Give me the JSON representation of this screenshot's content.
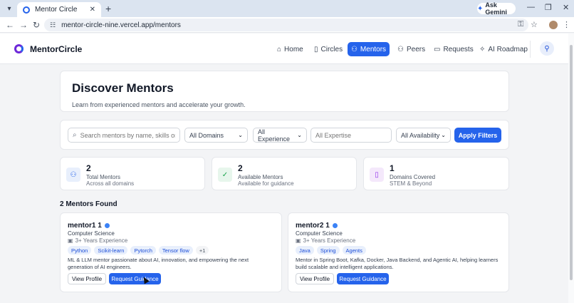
{
  "browser": {
    "tab_title": "Mentor Circle",
    "url": "mentor-circle-nine.vercel.app/mentors",
    "ask_gemini": "Ask Gemini"
  },
  "app": {
    "brand": "MentorCircle",
    "nav": [
      {
        "label": "Home",
        "icon": "home-icon"
      },
      {
        "label": "Circles",
        "icon": "book-icon"
      },
      {
        "label": "Mentors",
        "icon": "users-icon",
        "active": true
      },
      {
        "label": "Peers",
        "icon": "users-icon"
      },
      {
        "label": "Requests",
        "icon": "message-icon"
      },
      {
        "label": "AI Roadmap",
        "icon": "sparkles-icon"
      }
    ]
  },
  "hero": {
    "title": "Discover Mentors",
    "subtitle": "Learn from experienced mentors and accelerate your growth."
  },
  "filters": {
    "search_placeholder": "Search mentors by name, skills or domain",
    "domain": "All Domains",
    "experience": "All Experience",
    "expertise_placeholder": "All Expertise",
    "availability": "All Availability",
    "apply_label": "Apply Filters"
  },
  "stats": [
    {
      "value": "2",
      "label": "Total Mentors",
      "sub": "Across all domains",
      "icon": "users-icon"
    },
    {
      "value": "2",
      "label": "Available Mentors",
      "sub": "Available for guidance",
      "icon": "user-check-icon"
    },
    {
      "value": "1",
      "label": "Domains Covered",
      "sub": "STEM & Beyond",
      "icon": "book-open-icon"
    }
  ],
  "found_label": "2 Mentors Found",
  "mentors": [
    {
      "name": "mentor1 1",
      "domain": "Computer Science",
      "experience": "3+ Years Experience",
      "tags": [
        "Python",
        "Scikit-learn",
        "Pytorch",
        "Tensor flow"
      ],
      "more": "+1",
      "bio": "ML & LLM mentor passionate about AI, innovation, and empowering the next generation of AI engineers.",
      "view_label": "View Profile",
      "request_label": "Request Guidance"
    },
    {
      "name": "mentor2 1",
      "domain": "Computer Science",
      "experience": "3+ Years Experience",
      "tags": [
        "Java",
        "Spring",
        "Agents"
      ],
      "bio": "Mentor in Spring Boot, Kafka, Docker, Java Backend, and Agentic AI, helping learners build scalable and intelligent applications.",
      "view_label": "View Profile",
      "request_label": "Request Guidance"
    }
  ],
  "colors": {
    "accent": "#2563eb",
    "page_bg": "#f3f4f6"
  }
}
